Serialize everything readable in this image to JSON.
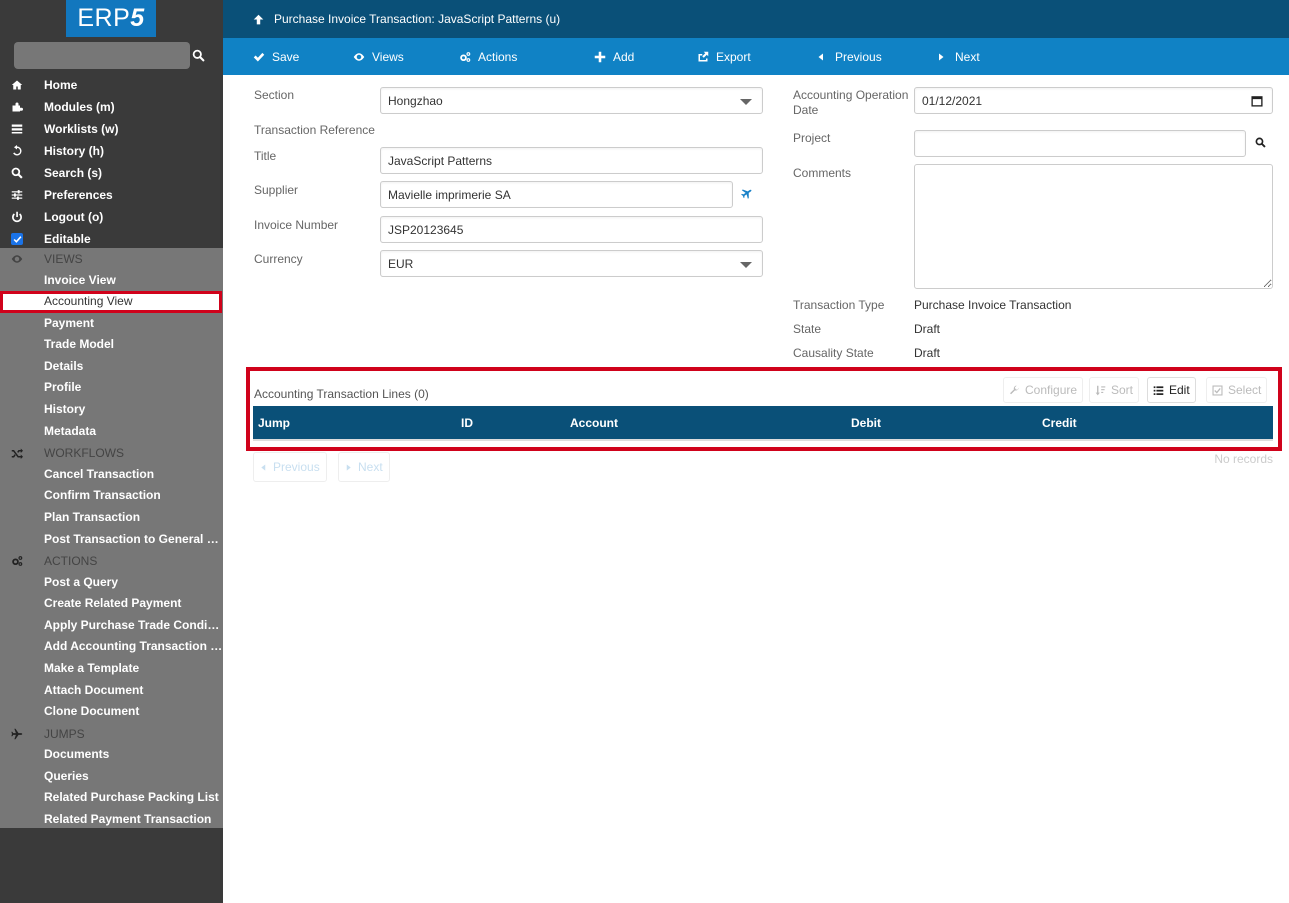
{
  "app": {
    "logo_text": "ERP",
    "logo_digit": "5"
  },
  "sidebar": {
    "search": {
      "value": "",
      "placeholder": ""
    },
    "nav_items": [
      {
        "label": "Home",
        "icon": "home-icon"
      },
      {
        "label": "Modules (m)",
        "icon": "puzzle-icon"
      },
      {
        "label": "Worklists (w)",
        "icon": "tasks-icon"
      },
      {
        "label": "History (h)",
        "icon": "history-icon"
      },
      {
        "label": "Search (s)",
        "icon": "search-icon"
      },
      {
        "label": "Preferences",
        "icon": "sliders-icon"
      },
      {
        "label": "Logout (o)",
        "icon": "power-icon"
      },
      {
        "label": "Editable",
        "icon": "checkbox-checked-icon",
        "checked": true
      }
    ],
    "views": {
      "header": "VIEWS",
      "items": [
        "Invoice View",
        "Accounting View",
        "Payment",
        "Trade Model",
        "Details",
        "Profile",
        "History",
        "Metadata"
      ],
      "active": "Accounting View"
    },
    "workflows": {
      "header": "WORKFLOWS",
      "items": [
        "Cancel Transaction",
        "Confirm Transaction",
        "Plan Transaction",
        "Post Transaction to General L..."
      ]
    },
    "actions": {
      "header": "ACTIONS",
      "items": [
        "Post a Query",
        "Create Related Payment",
        "Apply Purchase Trade Conditi...",
        "Add Accounting Transaction L...",
        "Make a Template",
        "Attach Document",
        "Clone Document"
      ]
    },
    "jumps": {
      "header": "JUMPS",
      "items": [
        "Documents",
        "Queries",
        "Related Purchase Packing List",
        "Related Payment Transaction"
      ]
    }
  },
  "header": {
    "title": "Purchase Invoice Transaction: JavaScript Patterns (u)",
    "toolbar": {
      "save": "Save",
      "views": "Views",
      "actions": "Actions",
      "add": "Add",
      "export": "Export",
      "previous": "Previous",
      "next": "Next"
    }
  },
  "form": {
    "section": {
      "label": "Section",
      "value": "Hongzhao"
    },
    "transaction_reference": {
      "label": "Transaction Reference"
    },
    "title": {
      "label": "Title",
      "value": "JavaScript Patterns"
    },
    "supplier": {
      "label": "Supplier",
      "value": "Mavielle imprimerie SA"
    },
    "invoice_number": {
      "label": "Invoice Number",
      "value": "JSP20123645"
    },
    "currency": {
      "label": "Currency",
      "value": "EUR"
    },
    "accounting_operation_date": {
      "label_line1": "Accounting Operation",
      "label_line2": "Date",
      "value": "01/12/2021"
    },
    "project": {
      "label": "Project",
      "value": ""
    },
    "comments": {
      "label": "Comments",
      "value": ""
    },
    "transaction_type": {
      "label": "Transaction Type",
      "value": "Purchase Invoice Transaction"
    },
    "state": {
      "label": "State",
      "value": "Draft"
    },
    "causality_state": {
      "label": "Causality State",
      "value": "Draft"
    }
  },
  "listbox": {
    "title": "Accounting Transaction Lines (0)",
    "buttons": {
      "configure": "Configure",
      "sort": "Sort",
      "edit": "Edit",
      "select": "Select"
    },
    "columns": [
      "Jump",
      "ID",
      "Account",
      "Debit",
      "Credit"
    ],
    "rows": [],
    "pagination": {
      "previous": "Previous",
      "next": "Next"
    },
    "status": "No records"
  },
  "colors": {
    "title_bar": "#0a5078",
    "toolbar": "#1082c5",
    "sidebar_dark": "#3a3a3a",
    "sidebar_panel": "#777777",
    "highlight": "#d0021b"
  }
}
